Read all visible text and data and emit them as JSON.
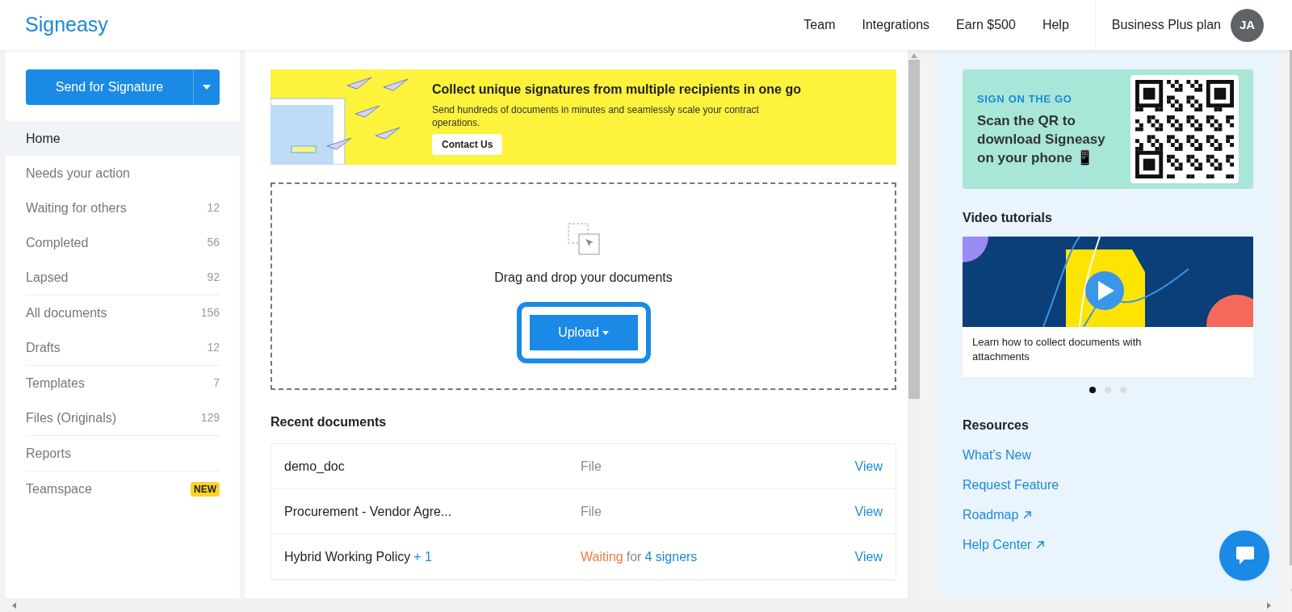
{
  "header": {
    "logo": "Signeasy",
    "nav": [
      "Team",
      "Integrations",
      "Earn $500",
      "Help"
    ],
    "plan": "Business Plus plan",
    "avatar": "JA"
  },
  "sidebar": {
    "send_button": "Send for Signature",
    "groups": [
      [
        {
          "label": "Home",
          "selected": true
        },
        {
          "label": "Needs your action",
          "selected": false
        },
        {
          "label": "Waiting for others",
          "count": "12",
          "selected": false
        },
        {
          "label": "Completed",
          "count": "56",
          "selected": false
        },
        {
          "label": "Lapsed",
          "count": "92",
          "selected": false
        }
      ],
      [
        {
          "label": "All documents",
          "count": "156",
          "selected": false
        },
        {
          "label": "Drafts",
          "count": "12",
          "selected": false
        }
      ],
      [
        {
          "label": "Templates",
          "count": "7",
          "selected": false
        },
        {
          "label": "Files (Originals)",
          "count": "129",
          "selected": false
        }
      ],
      [
        {
          "label": "Reports",
          "selected": false
        }
      ],
      [
        {
          "label": "Teamspace",
          "badge": "NEW",
          "selected": false
        }
      ]
    ]
  },
  "banner": {
    "title": "Collect unique signatures from multiple recipients in one go",
    "text": "Send hundreds of documents in minutes and seamlessly scale your contract operations.",
    "button": "Contact Us"
  },
  "dropzone": {
    "text": "Drag and drop your documents",
    "upload_button": "Upload",
    "highlighted": true
  },
  "recent": {
    "title": "Recent documents",
    "rows": [
      {
        "name": "demo_doc",
        "status": [
          {
            "text": "File",
            "kind": "muted"
          }
        ],
        "action": "View"
      },
      {
        "name": "Procurement - Vendor Agre...",
        "status": [
          {
            "text": "File",
            "kind": "muted"
          }
        ],
        "action": "View"
      },
      {
        "name": "Hybrid Working Policy",
        "extra": "+ 1",
        "status": [
          {
            "text": "Waiting",
            "kind": "warning"
          },
          {
            "text": "for",
            "kind": "muted"
          },
          {
            "text": "4 signers",
            "kind": "link"
          }
        ],
        "action": "View"
      }
    ]
  },
  "right": {
    "qr_card": {
      "eyebrow": "SIGN ON THE GO",
      "text": "Scan the QR to download Signeasy on your phone 📱"
    },
    "video": {
      "title": "Video tutorials",
      "caption": "Learn how to collect documents with attachments",
      "dots": [
        {
          "selected": true
        },
        {
          "selected": false
        },
        {
          "selected": false
        }
      ]
    },
    "resources": {
      "title": "Resources",
      "links": [
        {
          "label": "What’s New",
          "external": false
        },
        {
          "label": "Request Feature",
          "external": false
        },
        {
          "label": "Roadmap",
          "external": true
        },
        {
          "label": "Help Center",
          "external": true
        }
      ]
    }
  }
}
